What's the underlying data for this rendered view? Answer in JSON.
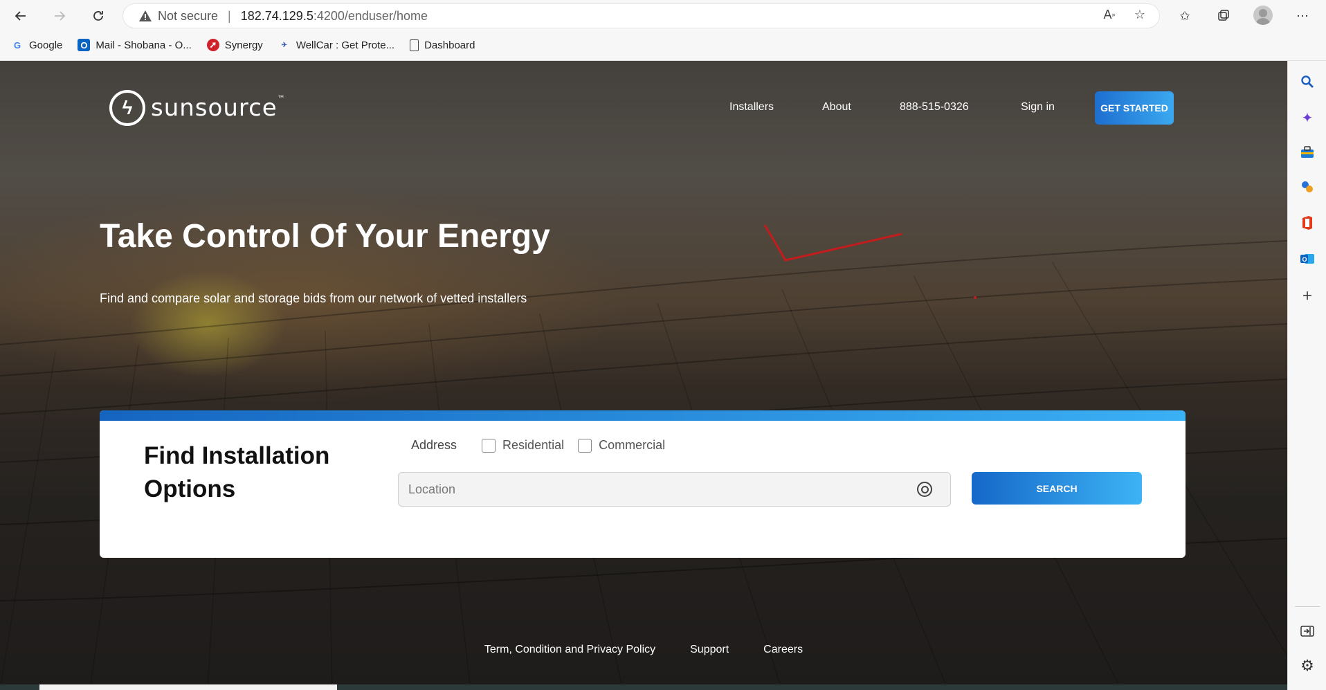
{
  "browser": {
    "security_label": "Not secure",
    "url_host": "182.74.129.5",
    "url_path": ":4200/enduser/home",
    "bookmarks": [
      {
        "label": "Google",
        "icon": "google-icon"
      },
      {
        "label": "Mail - Shobana - O...",
        "icon": "outlook-icon"
      },
      {
        "label": "Synergy",
        "icon": "synergy-icon"
      },
      {
        "label": "WellCar : Get Prote...",
        "icon": "wellcar-icon"
      },
      {
        "label": "Dashboard",
        "icon": "page-icon"
      }
    ]
  },
  "site": {
    "logo_text": "sunsource",
    "logo_tm": "™",
    "nav": {
      "installers": "Installers",
      "about": "About",
      "phone": "888-515-0326",
      "signin": "Sign in",
      "cta": "GET STARTED"
    },
    "hero": {
      "title": "Take Control Of Your Energy",
      "subtitle": "Find and compare solar and storage bids from our network of vetted installers"
    },
    "finder": {
      "title": "Find Installation Options",
      "address_label": "Address",
      "residential": "Residential",
      "commercial": "Commercial",
      "location_placeholder": "Location",
      "search_label": "SEARCH"
    },
    "footer": {
      "terms": "Term, Condition and Privacy Policy",
      "support": "Support",
      "careers": "Careers"
    }
  },
  "colors": {
    "accent": "#1e6fd0",
    "accent_light": "#3aa8f0",
    "annotation": "#e02020"
  }
}
